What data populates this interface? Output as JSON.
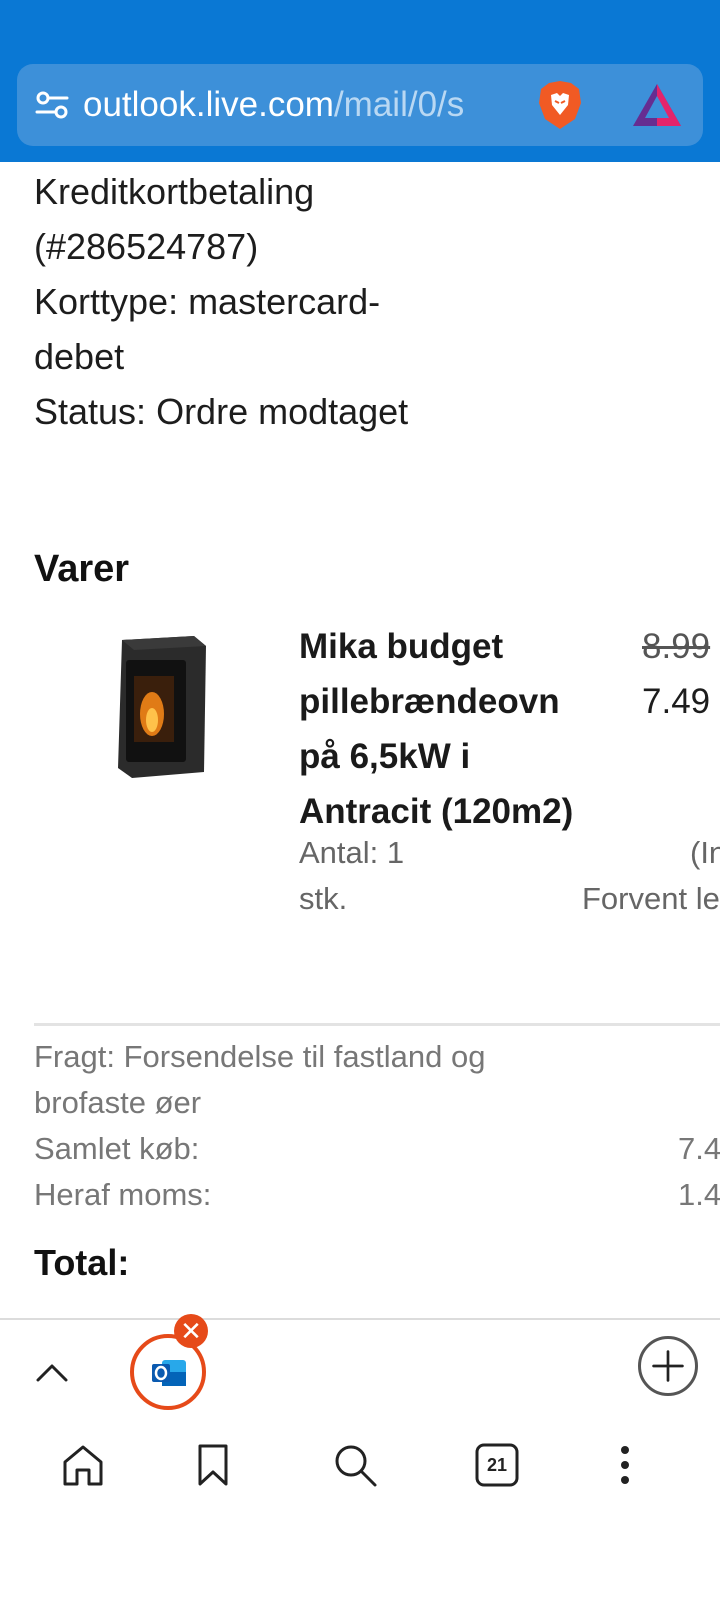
{
  "browser": {
    "url_host": "outlook.live.com",
    "url_path": "/mail/0/s",
    "icons": [
      "site-settings-icon",
      "brave-shields-icon",
      "brave-rewards-icon"
    ],
    "colors": {
      "toolbar": "#0a78d4",
      "urlbar": "#3d90d9"
    }
  },
  "order": {
    "payment_lines": [
      "Kreditkortbetaling",
      "(#286524787)",
      "Korttype: mastercard-",
      "debet",
      "Status: Ordre modtaget"
    ],
    "items_title": "Varer",
    "product": {
      "name_lines": [
        "Mika budget",
        "pillebrændeovn",
        "på 6,5kW i",
        "Antracit (120m2)"
      ],
      "price_old": "8.99",
      "price_new": "7.49",
      "qty_lines": [
        "Antal: 1",
        "stk."
      ],
      "incl_text": "(In",
      "delivery_text": "Forvent le"
    },
    "shipping_lines": [
      "Fragt: Forsendelse til fastland og",
      "brofaste øer"
    ],
    "total_purchase_label": "Samlet køb:",
    "total_purchase_value": "7.4",
    "vat_label": "Heraf moms:",
    "vat_value": "1.4",
    "total_label": "Total:"
  },
  "bottom_bar": {
    "tab_count": "21",
    "icons": [
      "chevron-up-icon",
      "outlook-icon",
      "close-icon",
      "plus-icon",
      "home-icon",
      "bookmark-icon",
      "search-icon",
      "tabs-icon",
      "more-icon"
    ],
    "accent": "#e64a19"
  }
}
